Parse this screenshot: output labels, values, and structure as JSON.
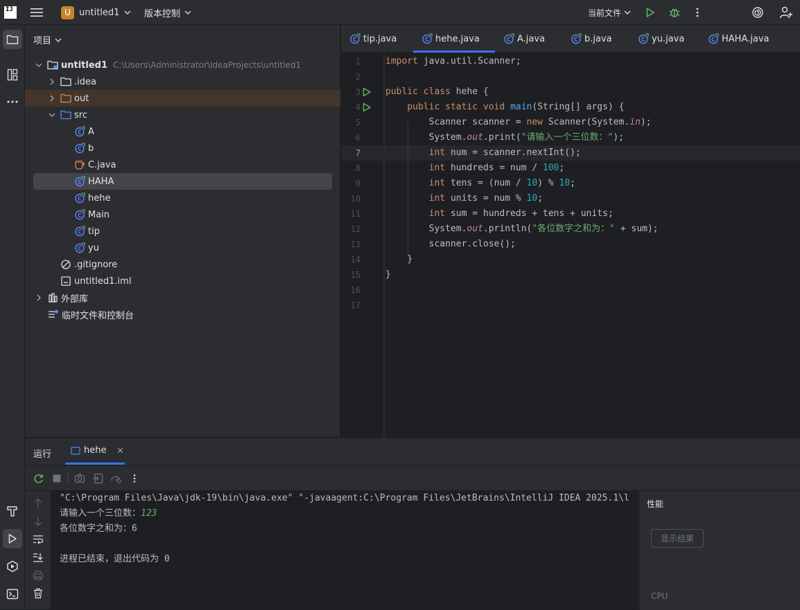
{
  "titlebar": {
    "logo_text": "IJ",
    "project_badge": "U",
    "project_name": "untitled1",
    "vcs_label": "版本控制",
    "run_config": "当前文件"
  },
  "project_panel": {
    "title": "项目",
    "tree": [
      {
        "label": "untitled1",
        "hint": "C:\\Users\\Administrator\\IdeaProjects\\untitled1"
      },
      {
        "label": ".idea"
      },
      {
        "label": "out"
      },
      {
        "label": "src"
      },
      {
        "label": "A"
      },
      {
        "label": "b"
      },
      {
        "label": "C.java"
      },
      {
        "label": "HAHA"
      },
      {
        "label": "hehe"
      },
      {
        "label": "Main"
      },
      {
        "label": "tip"
      },
      {
        "label": "yu"
      },
      {
        "label": ".gitignore"
      },
      {
        "label": "untitled1.iml"
      },
      {
        "label": "外部库"
      },
      {
        "label": "临时文件和控制台"
      }
    ]
  },
  "editor": {
    "tabs": [
      {
        "label": "tip.java"
      },
      {
        "label": "hehe.java"
      },
      {
        "label": "A.java"
      },
      {
        "label": "b.java"
      },
      {
        "label": "yu.java"
      },
      {
        "label": "HAHA.java"
      }
    ],
    "active_tab": "hehe.java",
    "current_line": 7,
    "line_numbers": [
      "1",
      "2",
      "3",
      "4",
      "5",
      "6",
      "7",
      "8",
      "9",
      "10",
      "11",
      "12",
      "13",
      "14",
      "15",
      "16",
      "17"
    ],
    "code": [
      "import java.util.Scanner;",
      "",
      "public class hehe {",
      "    public static void main(String[] args) {",
      "        Scanner scanner = new Scanner(System.in);",
      "        System.out.print(\"请输入一个三位数：\");",
      "        int num = scanner.nextInt();",
      "        int hundreds = num / 100;",
      "        int tens = (num / 10) % 10;",
      "        int units = num % 10;",
      "        int sum = hundreds + tens + units;",
      "        System.out.println(\"各位数字之和为：\" + sum);",
      "        scanner.close();",
      "    }",
      "}",
      "",
      ""
    ]
  },
  "run_panel": {
    "title": "运行",
    "tab_label": "hehe",
    "console": {
      "command": "\"C:\\Program Files\\Java\\jdk-19\\bin\\java.exe\" \"-javaagent:C:\\Program Files\\JetBrains\\IntelliJ IDEA 2025.1\\l",
      "prompt": "请输入一个三位数：",
      "input": "123",
      "result": "各位数字之和为：6",
      "exit": "进程已结束，退出代码为 0"
    },
    "perf": {
      "title": "性能",
      "show_results": "显示结果",
      "cpu_label": "CPU"
    }
  },
  "colors": {
    "accent": "#3574f0",
    "keyword": "#cf8e6d",
    "method": "#56a8f5",
    "number": "#2aacb8",
    "string": "#6aab73",
    "run_green": "#5fb865"
  }
}
